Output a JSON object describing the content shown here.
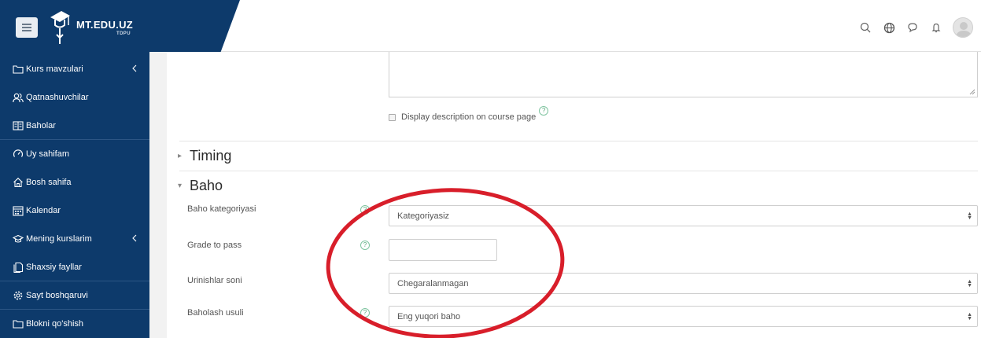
{
  "header": {
    "brand_name": "MT.EDU.UZ",
    "brand_sub": "TDPU",
    "icons": [
      "search-icon",
      "globe-icon",
      "chat-icon",
      "bell-icon",
      "user-avatar"
    ]
  },
  "sidebar": {
    "items": [
      {
        "label": "Kurs mavzulari",
        "icon": "folder-icon",
        "has_chevron": true
      },
      {
        "label": "Qatnashuvchilar",
        "icon": "users-icon",
        "has_chevron": false
      },
      {
        "label": "Baholar",
        "icon": "gradebook-icon",
        "has_chevron": false
      },
      {
        "label": "Uy sahifam",
        "icon": "dashboard-icon",
        "has_chevron": false
      },
      {
        "label": "Bosh sahifa",
        "icon": "home-icon",
        "has_chevron": false
      },
      {
        "label": "Kalendar",
        "icon": "calendar-icon",
        "has_chevron": false
      },
      {
        "label": "Mening kurslarim",
        "icon": "graduation-cap-icon",
        "has_chevron": true
      },
      {
        "label": "Shaxsiy fayllar",
        "icon": "files-icon",
        "has_chevron": false
      },
      {
        "label": "Sayt boshqaruvi",
        "icon": "gear-icon",
        "has_chevron": false
      },
      {
        "label": "Blokni qo'shish",
        "icon": "folder-icon",
        "has_chevron": false
      }
    ]
  },
  "main": {
    "description_checkbox_label": "Display description on course page",
    "sections": {
      "timing": "Timing",
      "grade": "Baho"
    },
    "fields": {
      "grade_category": {
        "label": "Baho kategoriyasi",
        "value": "Kategoriyasiz"
      },
      "grade_to_pass": {
        "label": "Grade to pass",
        "value": ""
      },
      "attempts": {
        "label": "Urinishlar soni",
        "value": "Chegaralanmagan"
      },
      "grading_method": {
        "label": "Baholash usuli",
        "value": "Eng yuqori baho"
      }
    },
    "help_glyph": "?",
    "select_arrows": {
      "up": "▲",
      "down": "▼"
    },
    "caret_collapsed": "▸",
    "caret_expanded": "▾"
  },
  "colors": {
    "sidebar_bg": "#0d3a6b",
    "help_green": "#56a87a",
    "highlight_red": "#d81e2a"
  }
}
